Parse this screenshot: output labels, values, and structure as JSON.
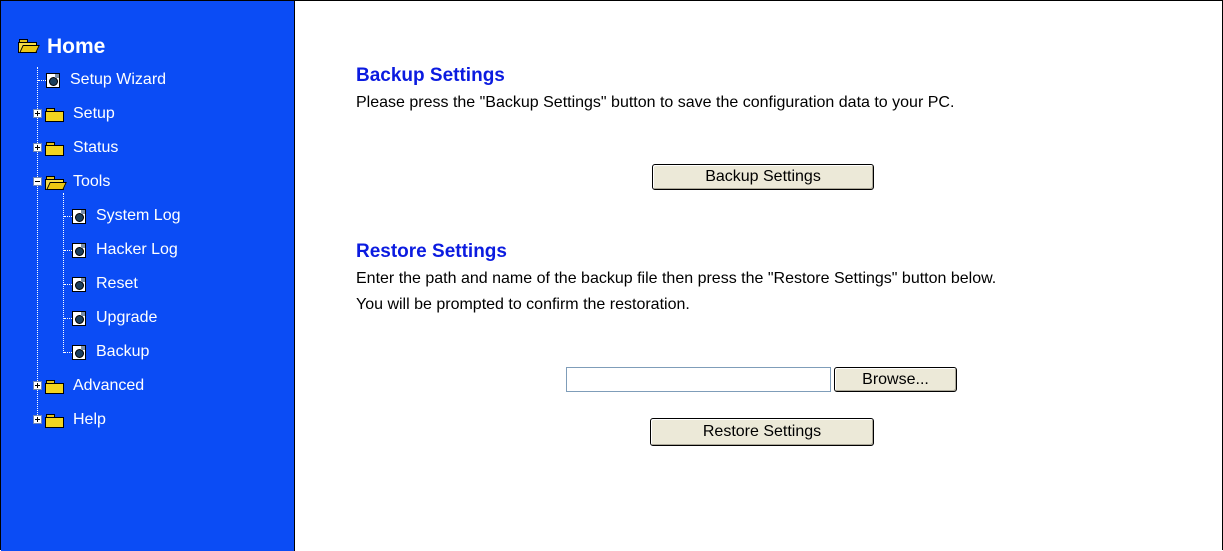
{
  "sidebar": {
    "home_label": "Home",
    "items": [
      {
        "label": "Setup Wizard",
        "icon": "page-icon"
      },
      {
        "label": "Setup",
        "icon": "folder-icon",
        "expander": "plus"
      },
      {
        "label": "Status",
        "icon": "folder-icon",
        "expander": "plus"
      },
      {
        "label": "Tools",
        "icon": "folder-open-icon",
        "expander": "minus"
      },
      {
        "label": "System Log",
        "icon": "page-icon"
      },
      {
        "label": "Hacker Log",
        "icon": "page-icon"
      },
      {
        "label": "Reset",
        "icon": "page-icon"
      },
      {
        "label": "Upgrade",
        "icon": "page-icon"
      },
      {
        "label": "Backup",
        "icon": "page-icon"
      },
      {
        "label": "Advanced",
        "icon": "folder-icon",
        "expander": "plus"
      },
      {
        "label": "Help",
        "icon": "folder-icon",
        "expander": "plus"
      }
    ],
    "background_color": "#0b4cf5"
  },
  "backup": {
    "title": "Backup Settings",
    "description": "Please press the \"Backup Settings\" button to save the configuration data to your PC.",
    "button_label": "Backup Settings"
  },
  "restore": {
    "title": "Restore Settings",
    "description_line1": "Enter the path and name of the backup file then press the \"Restore Settings\" button below.",
    "description_line2": "You will be prompted to confirm the restoration.",
    "file_value": "",
    "browse_label": "Browse...",
    "button_label": "Restore Settings"
  },
  "colors": {
    "heading": "#0b1be0",
    "sidebar": "#0b4cf5"
  }
}
